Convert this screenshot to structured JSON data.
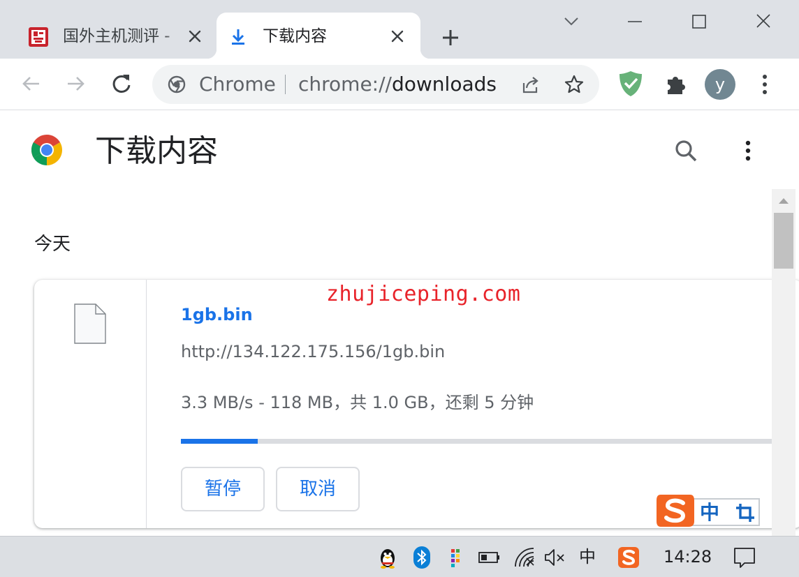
{
  "window": {
    "tabs": [
      {
        "title": "国外主机测评 - ",
        "active": false
      },
      {
        "title": "下载内容",
        "active": true
      }
    ]
  },
  "toolbar": {
    "omnibox_label": "Chrome",
    "url_scheme": "chrome://",
    "url_host": "downloads",
    "avatar_initial": "y"
  },
  "page": {
    "title": "下载内容",
    "date_heading": "今天",
    "watermark": "zhujiceping.com"
  },
  "download": {
    "file_name": "1gb.bin",
    "url": "http://134.122.175.156/1gb.bin",
    "status": "3.3 MB/s - 118 MB，共 1.0 GB，还剩 5 分钟",
    "progress": 0.13,
    "pause_label": "暂停",
    "cancel_label": "取消"
  },
  "ime": {
    "mode_char": "中"
  },
  "taskbar": {
    "ime_indicator": "中",
    "clock": "14:28"
  },
  "colors": {
    "accent": "#1a73e8",
    "tabstrip": "#dee1e6",
    "watermark": "#e8232a",
    "taskbar": "#dcdfe3"
  }
}
